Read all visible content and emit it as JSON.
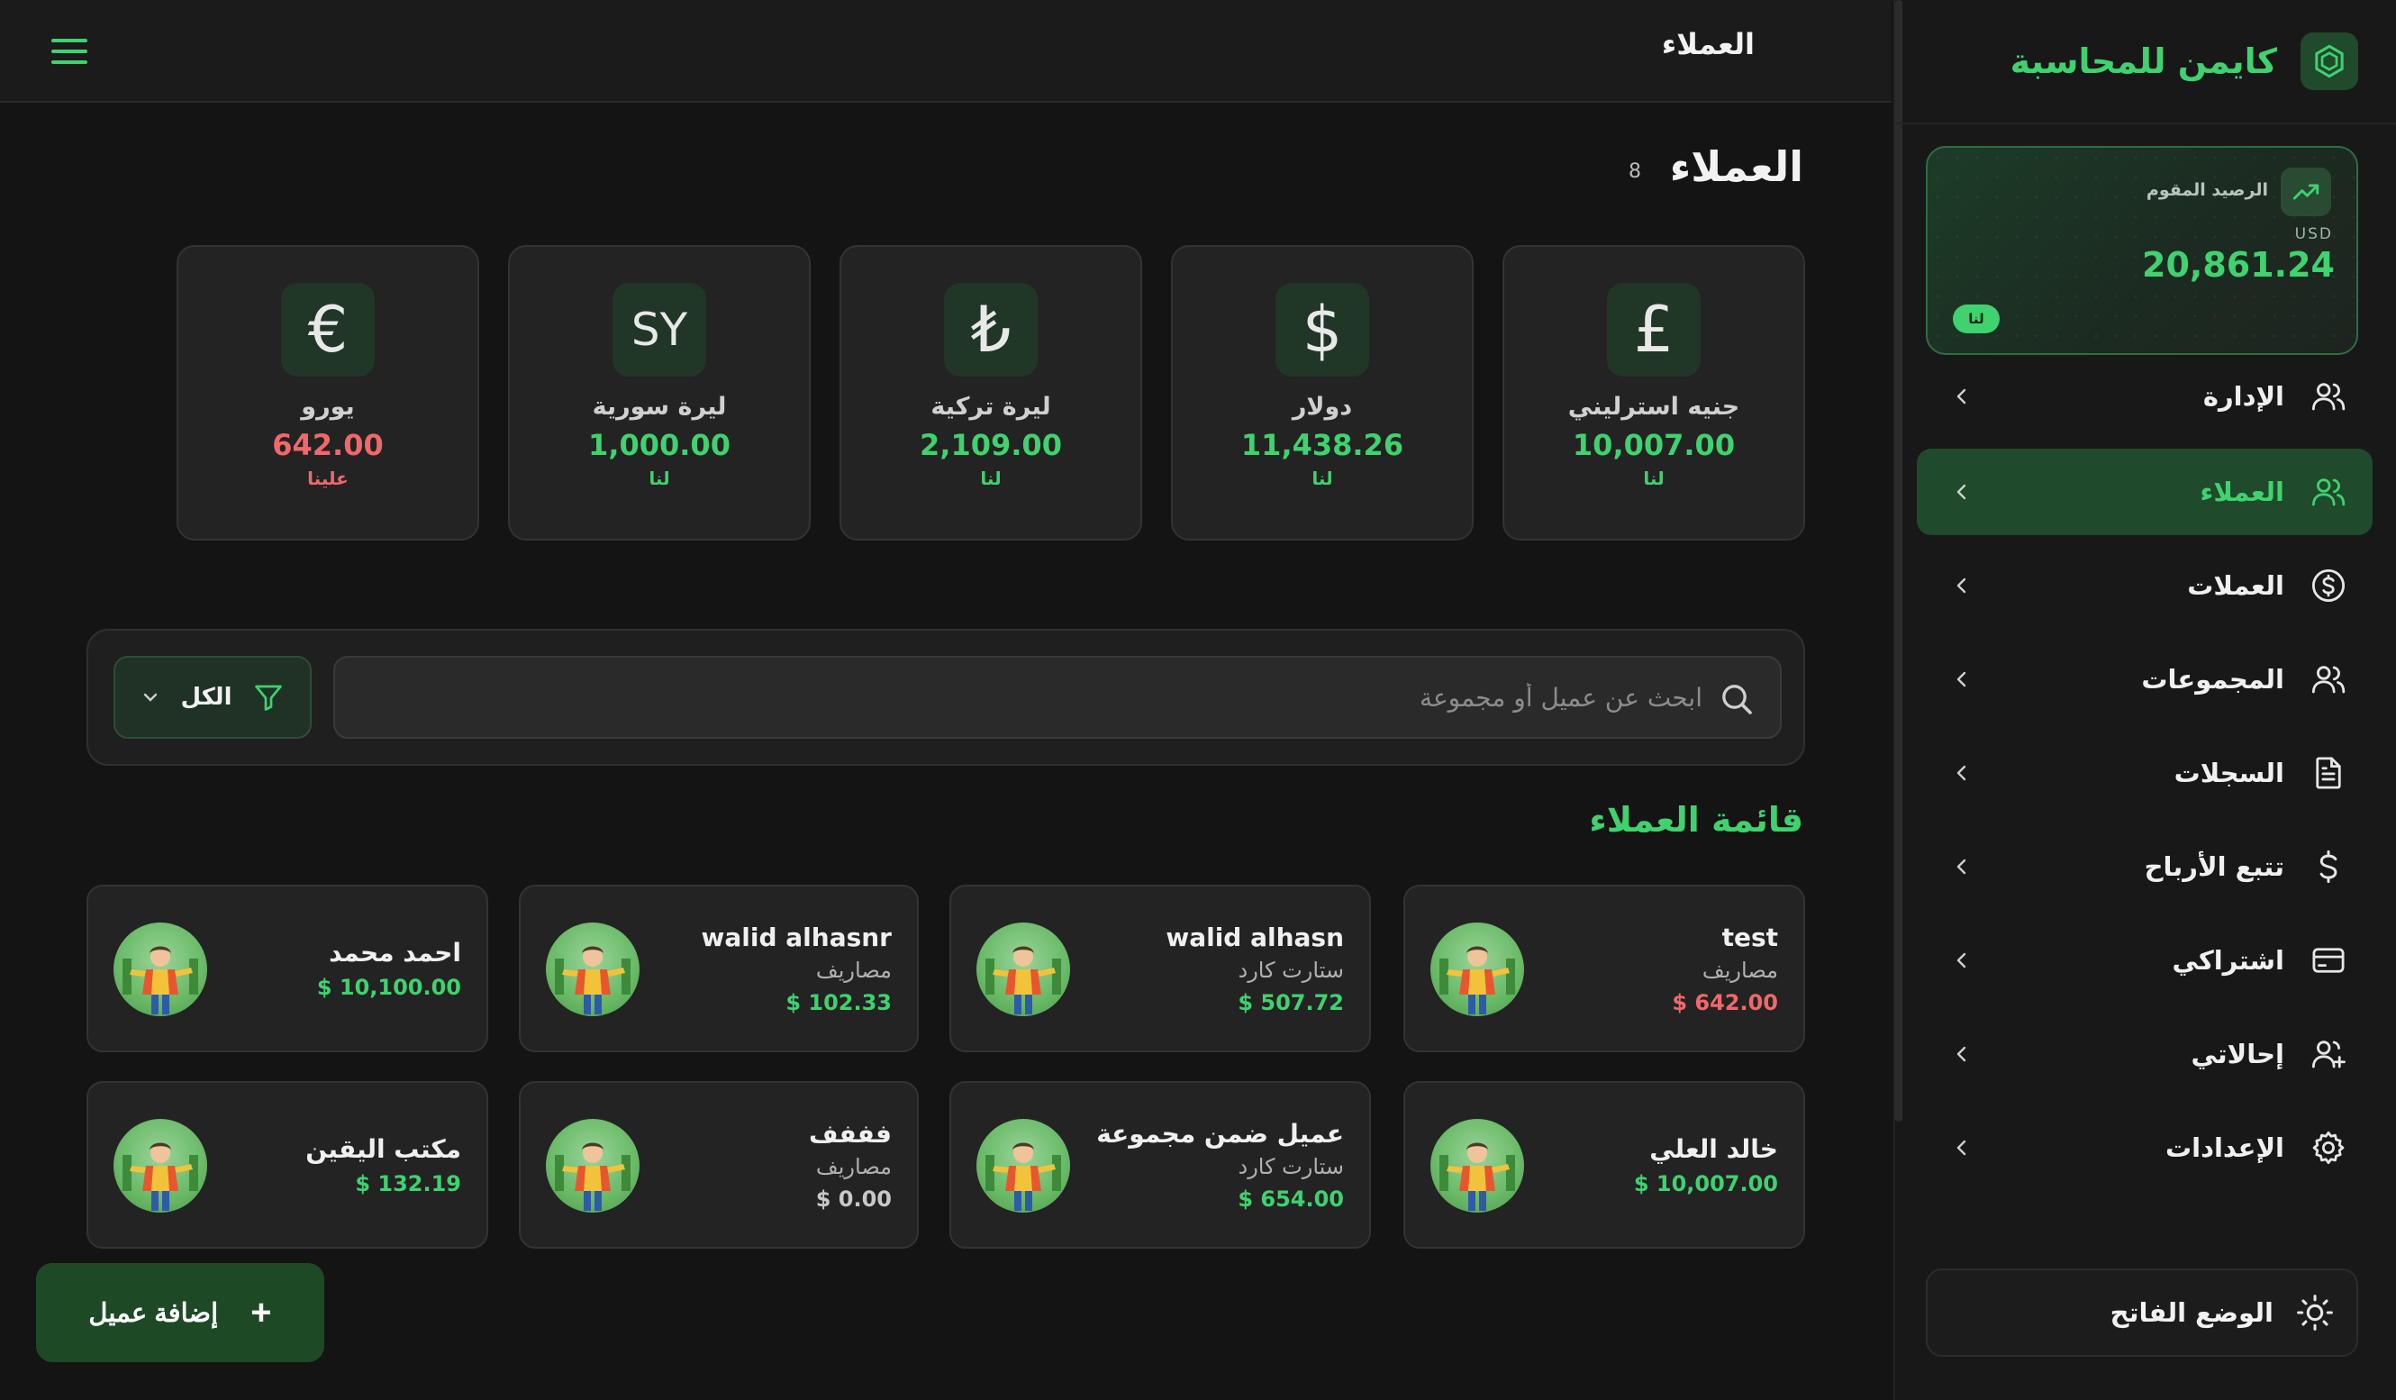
{
  "app": {
    "brand": "كايمن للمحاسبة"
  },
  "balance": {
    "label": "الرصيد المقوم",
    "currency": "USD",
    "amount": "20,861.24",
    "badge": "لنا"
  },
  "nav": [
    {
      "label": "الإدارة",
      "icon": "users-icon",
      "active": false
    },
    {
      "label": "العملاء",
      "icon": "users-icon",
      "active": true
    },
    {
      "label": "العملات",
      "icon": "dollar-circle-icon",
      "active": false
    },
    {
      "label": "المجموعات",
      "icon": "users-icon",
      "active": false
    },
    {
      "label": "السجلات",
      "icon": "document-icon",
      "active": false
    },
    {
      "label": "تتبع الأرباح",
      "icon": "dollar-icon",
      "active": false
    },
    {
      "label": "اشتراكي",
      "icon": "card-icon",
      "active": false
    },
    {
      "label": "إحالاتي",
      "icon": "user-plus-icon",
      "active": false
    },
    {
      "label": "الإعدادات",
      "icon": "gear-icon",
      "active": false
    }
  ],
  "light_mode": "الوضع الفاتح",
  "topbar": {
    "title": "العملاء"
  },
  "page": {
    "title": "العملاء",
    "count": "8"
  },
  "currencies": [
    {
      "symbol": "£",
      "name": "جنيه استرليني",
      "amount": "10,007.00",
      "sub": "لنا",
      "status": "positive"
    },
    {
      "symbol": "$",
      "name": "دولار",
      "amount": "11,438.26",
      "sub": "لنا",
      "status": "positive"
    },
    {
      "symbol": "₺",
      "name": "ليرة تركية",
      "amount": "2,109.00",
      "sub": "لنا",
      "status": "positive"
    },
    {
      "symbol": "SY",
      "name": "ليرة سورية",
      "amount": "1,000.00",
      "sub": "لنا",
      "status": "positive"
    },
    {
      "symbol": "€",
      "name": "يورو",
      "amount": "642.00",
      "sub": "علينا",
      "status": "negative"
    }
  ],
  "search": {
    "placeholder": "ابحث عن عميل أو مجموعة",
    "value": ""
  },
  "filter": {
    "label": "الكل"
  },
  "list": {
    "title": "قائمة العملاء"
  },
  "clients": [
    {
      "name": "test",
      "group": "مصاريف",
      "amount": "$ 642.00",
      "status": "negative"
    },
    {
      "name": "walid alhasn",
      "group": "ستارت كارد",
      "amount": "$ 507.72",
      "status": "positive"
    },
    {
      "name": "walid alhasnr",
      "group": "مصاريف",
      "amount": "$ 102.33",
      "status": "positive"
    },
    {
      "name": "احمد محمد",
      "group": "",
      "amount": "$ 10,100.00",
      "status": "positive"
    },
    {
      "name": "خالد العلي",
      "group": "",
      "amount": "$ 10,007.00",
      "status": "positive"
    },
    {
      "name": "عميل ضمن مجموعة",
      "group": "ستارت كارد",
      "amount": "$ 654.00",
      "status": "positive"
    },
    {
      "name": "فففف",
      "group": "مصاريف",
      "amount": "$ 0.00",
      "status": "neutral"
    },
    {
      "name": "مكتب اليقين",
      "group": "",
      "amount": "$ 132.19",
      "status": "positive"
    }
  ],
  "add_button": {
    "label": "إضافة عميل",
    "plus": "+"
  },
  "colors": {
    "accent": "#3fd26e",
    "negative": "#f0686b",
    "background": "#141414",
    "card": "#232323"
  }
}
